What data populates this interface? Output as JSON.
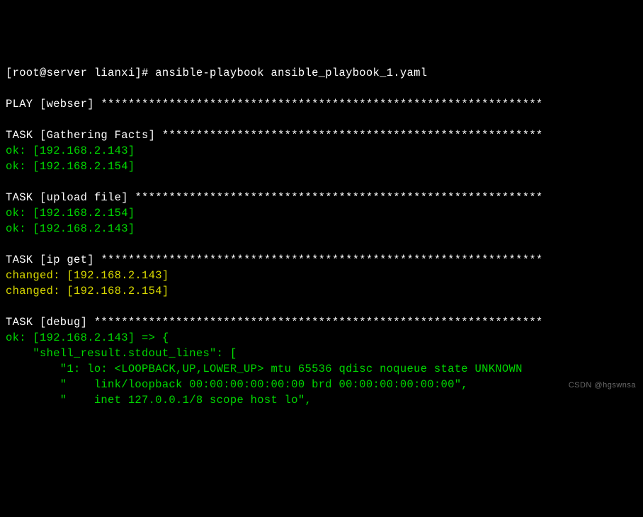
{
  "prompt": {
    "user_host": "[root@server lianxi]#",
    "command": "ansible-playbook ansible_playbook_1.yaml"
  },
  "play": {
    "label": "PLAY [webser]",
    "stars": "*****************************************************************"
  },
  "task_gathering": {
    "label": "TASK [Gathering Facts]",
    "stars": "********************************************************",
    "results": [
      "ok: [192.168.2.143]",
      "ok: [192.168.2.154]"
    ]
  },
  "task_upload": {
    "label": "TASK [upload file]",
    "stars": "************************************************************",
    "results": [
      "ok: [192.168.2.154]",
      "ok: [192.168.2.143]"
    ]
  },
  "task_ipget": {
    "label": "TASK [ip get]",
    "stars": "*****************************************************************",
    "results": [
      "changed: [192.168.2.143]",
      "changed: [192.168.2.154]"
    ]
  },
  "task_debug": {
    "label": "TASK [debug]",
    "stars": "******************************************************************",
    "result_header": "ok: [192.168.2.143] => {",
    "stdout_key": "    \"shell_result.stdout_lines\": [",
    "lines": [
      "        \"1: lo: <LOOPBACK,UP,LOWER_UP> mtu 65536 qdisc noqueue state UNKNOWN",
      "        \"    link/loopback 00:00:00:00:00:00 brd 00:00:00:00:00:00\",",
      "        \"    inet 127.0.0.1/8 scope host lo\","
    ]
  },
  "watermark": "CSDN @hgswnsa"
}
